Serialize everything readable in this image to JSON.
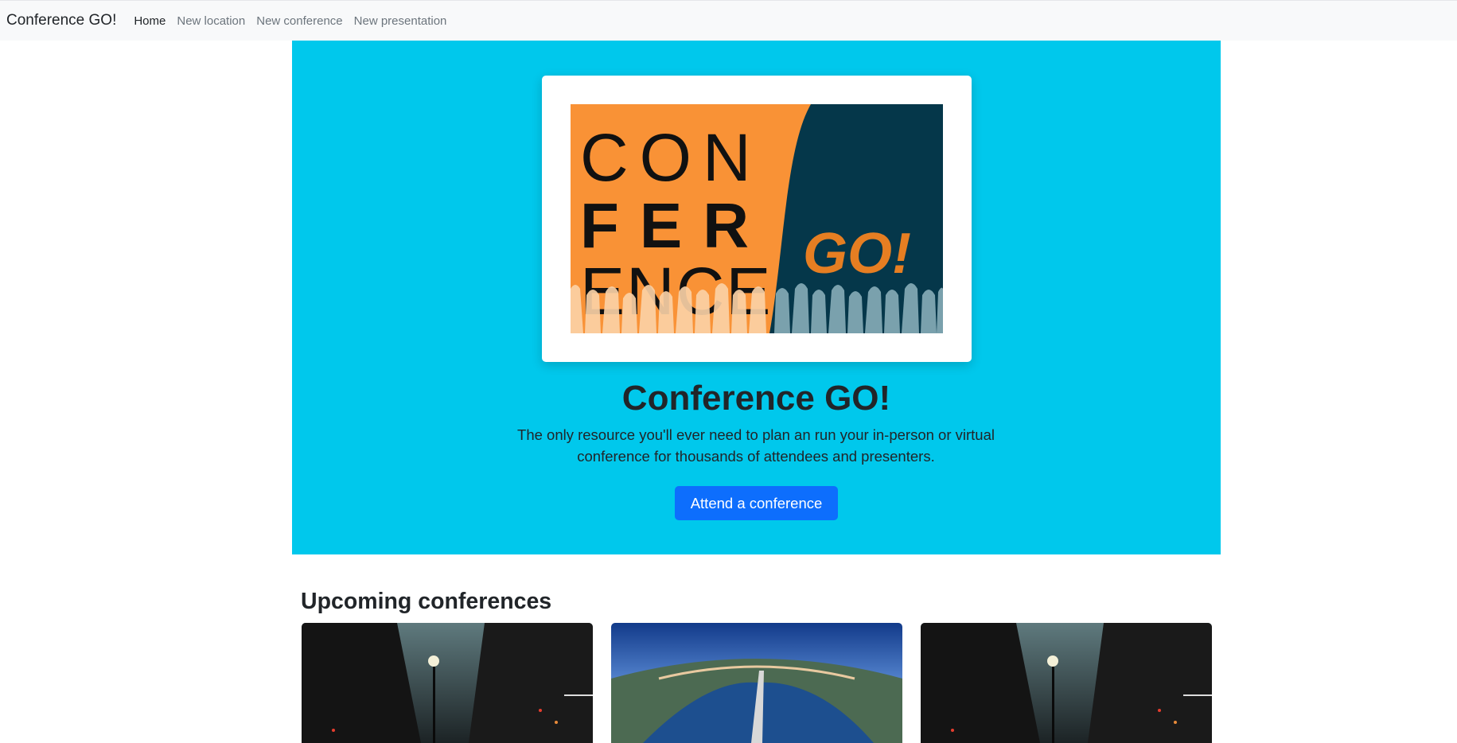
{
  "navbar": {
    "brand": "Conference GO!",
    "links": [
      "Home",
      "New location",
      "New conference",
      "New presentation"
    ],
    "active": "Home"
  },
  "hero": {
    "logo_alt": "CON FER ENCE GO!",
    "title": "Conference GO!",
    "lead": "The only resource you'll ever need to plan an run your in-person or virtual conference for thousands of attendees and presenters.",
    "cta_label": "Attend a conference"
  },
  "upcoming": {
    "heading": "Upcoming conferences",
    "cards": [
      {
        "image": "city-street-night-photo"
      },
      {
        "image": "panoramic-river-city-photo"
      },
      {
        "image": "city-street-night-photo"
      }
    ]
  },
  "colors": {
    "hero_bg": "#00c8ec",
    "primary": "#0d6efd",
    "logo_orange": "#f99236",
    "logo_navy": "#05374a"
  }
}
